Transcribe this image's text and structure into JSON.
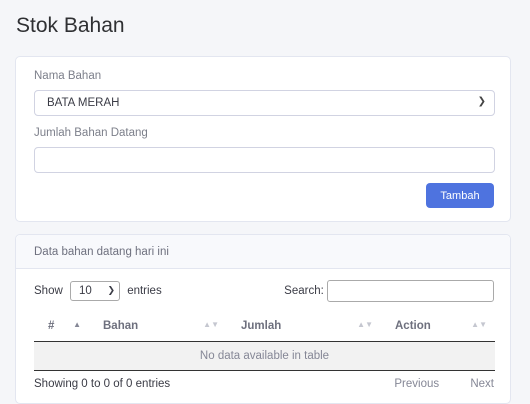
{
  "page": {
    "title": "Stok Bahan"
  },
  "form": {
    "material_label": "Nama Bahan",
    "material_value": "BATA MERAH",
    "quantity_label": "Jumlah Bahan Datang",
    "quantity_value": "",
    "submit_label": "Tambah"
  },
  "table_card": {
    "header": "Data bahan datang hari ini",
    "show_label": "Show",
    "length_value": "10",
    "entries_label": "entries",
    "search_label": "Search:",
    "columns": [
      "#",
      "Bahan",
      "Jumlah",
      "Action"
    ],
    "empty_message": "No data available in table",
    "info": "Showing 0 to 0 of 0 entries",
    "previous_label": "Previous",
    "next_label": "Next"
  },
  "colors": {
    "primary": "#4e73df"
  },
  "icons": {
    "select_caret": "chevron-down-icon",
    "sort": "sort-icon"
  }
}
